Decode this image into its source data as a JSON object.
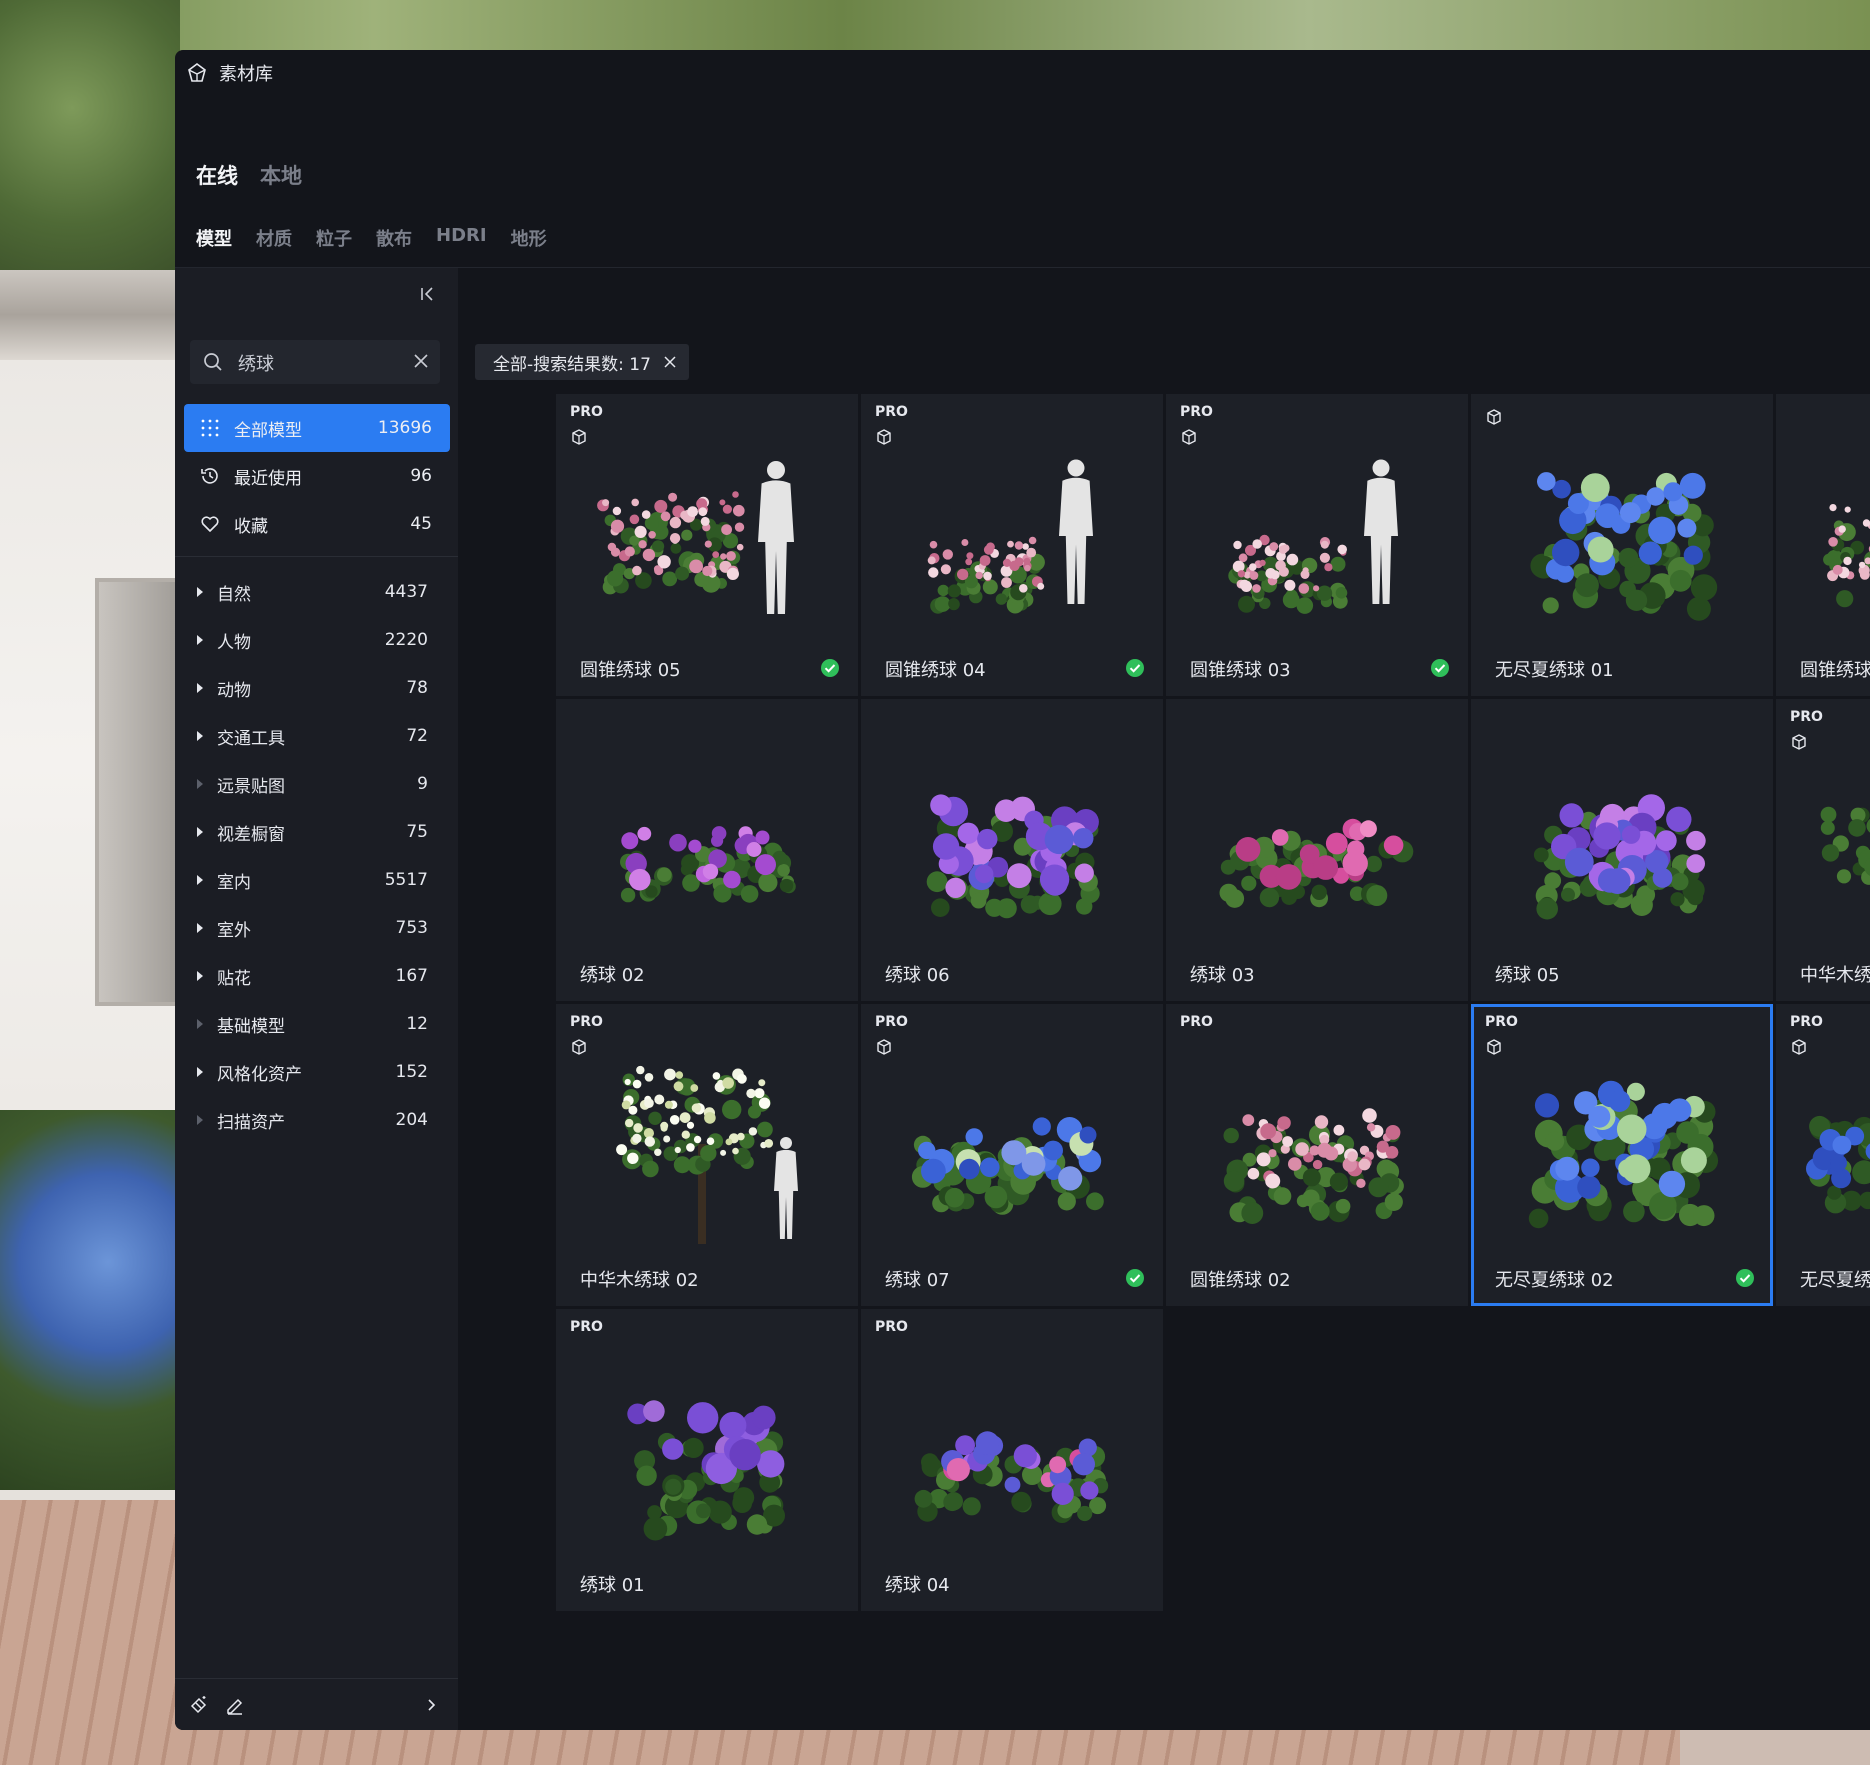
{
  "app": {
    "title": "素材库",
    "logo_icon": "app-logo-icon"
  },
  "source_tabs": [
    {
      "label": "在线",
      "active": true
    },
    {
      "label": "本地",
      "active": false
    }
  ],
  "type_tabs": [
    {
      "label": "模型",
      "active": true
    },
    {
      "label": "材质",
      "active": false
    },
    {
      "label": "粒子",
      "active": false
    },
    {
      "label": "散布",
      "active": false
    },
    {
      "label": "HDRI",
      "active": false
    },
    {
      "label": "地形",
      "active": false
    }
  ],
  "sidebar": {
    "search": {
      "value": "绣球",
      "placeholder": ""
    },
    "top_items": [
      {
        "label": "全部模型",
        "count": "13696",
        "icon": "grid-dots-icon",
        "active": true
      },
      {
        "label": "最近使用",
        "count": "96",
        "icon": "history-icon",
        "active": false
      },
      {
        "label": "收藏",
        "count": "45",
        "icon": "heart-icon",
        "active": false
      }
    ],
    "categories": [
      {
        "label": "自然",
        "count": "4437",
        "expandable": true
      },
      {
        "label": "人物",
        "count": "2220",
        "expandable": true
      },
      {
        "label": "动物",
        "count": "78",
        "expandable": true
      },
      {
        "label": "交通工具",
        "count": "72",
        "expandable": true
      },
      {
        "label": "远景贴图",
        "count": "9",
        "expandable": false
      },
      {
        "label": "视差橱窗",
        "count": "75",
        "expandable": true
      },
      {
        "label": "室内",
        "count": "5517",
        "expandable": true
      },
      {
        "label": "室外",
        "count": "753",
        "expandable": true
      },
      {
        "label": "贴花",
        "count": "167",
        "expandable": true
      },
      {
        "label": "基础模型",
        "count": "12",
        "expandable": false
      },
      {
        "label": "风格化资产",
        "count": "152",
        "expandable": true
      },
      {
        "label": "扫描资产",
        "count": "204",
        "expandable": false
      }
    ]
  },
  "filter_chip": {
    "label": "全部-搜索结果数: 17"
  },
  "assets": [
    {
      "name": "圆锥绣球 05",
      "pro": "PRO",
      "downloaded": true,
      "style": "panicle-person-tall",
      "col": 0,
      "row": 0
    },
    {
      "name": "圆锥绣球 04",
      "pro": "PRO",
      "downloaded": true,
      "style": "panicle-person-small",
      "col": 1,
      "row": 0
    },
    {
      "name": "圆锥绣球 03",
      "pro": "PRO",
      "downloaded": true,
      "style": "panicle-person-small",
      "col": 2,
      "row": 0
    },
    {
      "name": "无尽夏绣球 01",
      "pro": "",
      "downloaded": false,
      "style": "blue-bush",
      "col": 3,
      "row": 0
    },
    {
      "name": "圆锥绣球",
      "pro": "",
      "downloaded": false,
      "style": "panicle-partial",
      "col": 4,
      "row": 0
    },
    {
      "name": "绣球 02",
      "pro": "",
      "downloaded": false,
      "style": "purple-low",
      "col": 0,
      "row": 1
    },
    {
      "name": "绣球 06",
      "pro": "",
      "downloaded": false,
      "style": "purple-dense",
      "col": 1,
      "row": 1
    },
    {
      "name": "绣球 03",
      "pro": "",
      "downloaded": false,
      "style": "pink-low",
      "col": 2,
      "row": 1
    },
    {
      "name": "绣球 05",
      "pro": "",
      "downloaded": false,
      "style": "purple-dense",
      "col": 3,
      "row": 1
    },
    {
      "name": "中华木绣",
      "pro": "PRO",
      "downloaded": false,
      "style": "green-partial",
      "col": 4,
      "row": 1
    },
    {
      "name": "中华木绣球 02",
      "pro": "PRO",
      "downloaded": false,
      "style": "white-tree",
      "col": 0,
      "row": 2
    },
    {
      "name": "绣球 07",
      "pro": "PRO",
      "downloaded": true,
      "style": "blue-low",
      "col": 1,
      "row": 2
    },
    {
      "name": "圆锥绣球 02",
      "pro": "PRO",
      "downloaded": false,
      "style": "panicle-bush",
      "col": 2,
      "row": 2
    },
    {
      "name": "无尽夏绣球 02",
      "pro": "PRO",
      "downloaded": true,
      "style": "blue-bush",
      "selected": true,
      "col": 3,
      "row": 2
    },
    {
      "name": "无尽夏绣",
      "pro": "PRO",
      "downloaded": false,
      "style": "blue-partial",
      "col": 4,
      "row": 2
    },
    {
      "name": "绣球 01",
      "pro": "PRO",
      "downloaded": false,
      "style": "purple-bush",
      "col": 0,
      "row": 3
    },
    {
      "name": "绣球 04",
      "pro": "PRO",
      "downloaded": false,
      "style": "mixed-low",
      "col": 1,
      "row": 3
    }
  ],
  "colors": {
    "accent": "#2b7cf2",
    "check": "#2fbf5a",
    "panel": "#1b1d24",
    "card": "#1d2027"
  },
  "bottom_icons": [
    "magic-wand-icon",
    "edit-icon",
    "chevron-right-icon"
  ]
}
